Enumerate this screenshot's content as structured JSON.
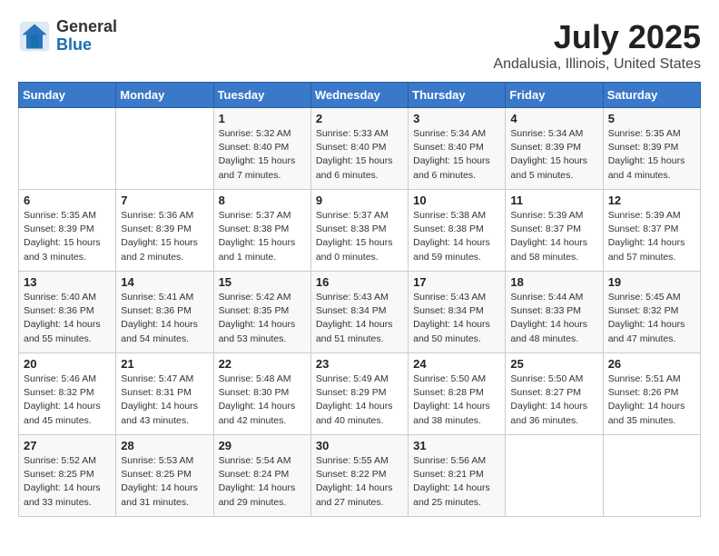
{
  "header": {
    "logo_line1": "General",
    "logo_line2": "Blue",
    "month_year": "July 2025",
    "location": "Andalusia, Illinois, United States"
  },
  "weekdays": [
    "Sunday",
    "Monday",
    "Tuesday",
    "Wednesday",
    "Thursday",
    "Friday",
    "Saturday"
  ],
  "weeks": [
    [
      {
        "day": "",
        "detail": ""
      },
      {
        "day": "",
        "detail": ""
      },
      {
        "day": "1",
        "detail": "Sunrise: 5:32 AM\nSunset: 8:40 PM\nDaylight: 15 hours\nand 7 minutes."
      },
      {
        "day": "2",
        "detail": "Sunrise: 5:33 AM\nSunset: 8:40 PM\nDaylight: 15 hours\nand 6 minutes."
      },
      {
        "day": "3",
        "detail": "Sunrise: 5:34 AM\nSunset: 8:40 PM\nDaylight: 15 hours\nand 6 minutes."
      },
      {
        "day": "4",
        "detail": "Sunrise: 5:34 AM\nSunset: 8:39 PM\nDaylight: 15 hours\nand 5 minutes."
      },
      {
        "day": "5",
        "detail": "Sunrise: 5:35 AM\nSunset: 8:39 PM\nDaylight: 15 hours\nand 4 minutes."
      }
    ],
    [
      {
        "day": "6",
        "detail": "Sunrise: 5:35 AM\nSunset: 8:39 PM\nDaylight: 15 hours\nand 3 minutes."
      },
      {
        "day": "7",
        "detail": "Sunrise: 5:36 AM\nSunset: 8:39 PM\nDaylight: 15 hours\nand 2 minutes."
      },
      {
        "day": "8",
        "detail": "Sunrise: 5:37 AM\nSunset: 8:38 PM\nDaylight: 15 hours\nand 1 minute."
      },
      {
        "day": "9",
        "detail": "Sunrise: 5:37 AM\nSunset: 8:38 PM\nDaylight: 15 hours\nand 0 minutes."
      },
      {
        "day": "10",
        "detail": "Sunrise: 5:38 AM\nSunset: 8:38 PM\nDaylight: 14 hours\nand 59 minutes."
      },
      {
        "day": "11",
        "detail": "Sunrise: 5:39 AM\nSunset: 8:37 PM\nDaylight: 14 hours\nand 58 minutes."
      },
      {
        "day": "12",
        "detail": "Sunrise: 5:39 AM\nSunset: 8:37 PM\nDaylight: 14 hours\nand 57 minutes."
      }
    ],
    [
      {
        "day": "13",
        "detail": "Sunrise: 5:40 AM\nSunset: 8:36 PM\nDaylight: 14 hours\nand 55 minutes."
      },
      {
        "day": "14",
        "detail": "Sunrise: 5:41 AM\nSunset: 8:36 PM\nDaylight: 14 hours\nand 54 minutes."
      },
      {
        "day": "15",
        "detail": "Sunrise: 5:42 AM\nSunset: 8:35 PM\nDaylight: 14 hours\nand 53 minutes."
      },
      {
        "day": "16",
        "detail": "Sunrise: 5:43 AM\nSunset: 8:34 PM\nDaylight: 14 hours\nand 51 minutes."
      },
      {
        "day": "17",
        "detail": "Sunrise: 5:43 AM\nSunset: 8:34 PM\nDaylight: 14 hours\nand 50 minutes."
      },
      {
        "day": "18",
        "detail": "Sunrise: 5:44 AM\nSunset: 8:33 PM\nDaylight: 14 hours\nand 48 minutes."
      },
      {
        "day": "19",
        "detail": "Sunrise: 5:45 AM\nSunset: 8:32 PM\nDaylight: 14 hours\nand 47 minutes."
      }
    ],
    [
      {
        "day": "20",
        "detail": "Sunrise: 5:46 AM\nSunset: 8:32 PM\nDaylight: 14 hours\nand 45 minutes."
      },
      {
        "day": "21",
        "detail": "Sunrise: 5:47 AM\nSunset: 8:31 PM\nDaylight: 14 hours\nand 43 minutes."
      },
      {
        "day": "22",
        "detail": "Sunrise: 5:48 AM\nSunset: 8:30 PM\nDaylight: 14 hours\nand 42 minutes."
      },
      {
        "day": "23",
        "detail": "Sunrise: 5:49 AM\nSunset: 8:29 PM\nDaylight: 14 hours\nand 40 minutes."
      },
      {
        "day": "24",
        "detail": "Sunrise: 5:50 AM\nSunset: 8:28 PM\nDaylight: 14 hours\nand 38 minutes."
      },
      {
        "day": "25",
        "detail": "Sunrise: 5:50 AM\nSunset: 8:27 PM\nDaylight: 14 hours\nand 36 minutes."
      },
      {
        "day": "26",
        "detail": "Sunrise: 5:51 AM\nSunset: 8:26 PM\nDaylight: 14 hours\nand 35 minutes."
      }
    ],
    [
      {
        "day": "27",
        "detail": "Sunrise: 5:52 AM\nSunset: 8:25 PM\nDaylight: 14 hours\nand 33 minutes."
      },
      {
        "day": "28",
        "detail": "Sunrise: 5:53 AM\nSunset: 8:25 PM\nDaylight: 14 hours\nand 31 minutes."
      },
      {
        "day": "29",
        "detail": "Sunrise: 5:54 AM\nSunset: 8:24 PM\nDaylight: 14 hours\nand 29 minutes."
      },
      {
        "day": "30",
        "detail": "Sunrise: 5:55 AM\nSunset: 8:22 PM\nDaylight: 14 hours\nand 27 minutes."
      },
      {
        "day": "31",
        "detail": "Sunrise: 5:56 AM\nSunset: 8:21 PM\nDaylight: 14 hours\nand 25 minutes."
      },
      {
        "day": "",
        "detail": ""
      },
      {
        "day": "",
        "detail": ""
      }
    ]
  ]
}
